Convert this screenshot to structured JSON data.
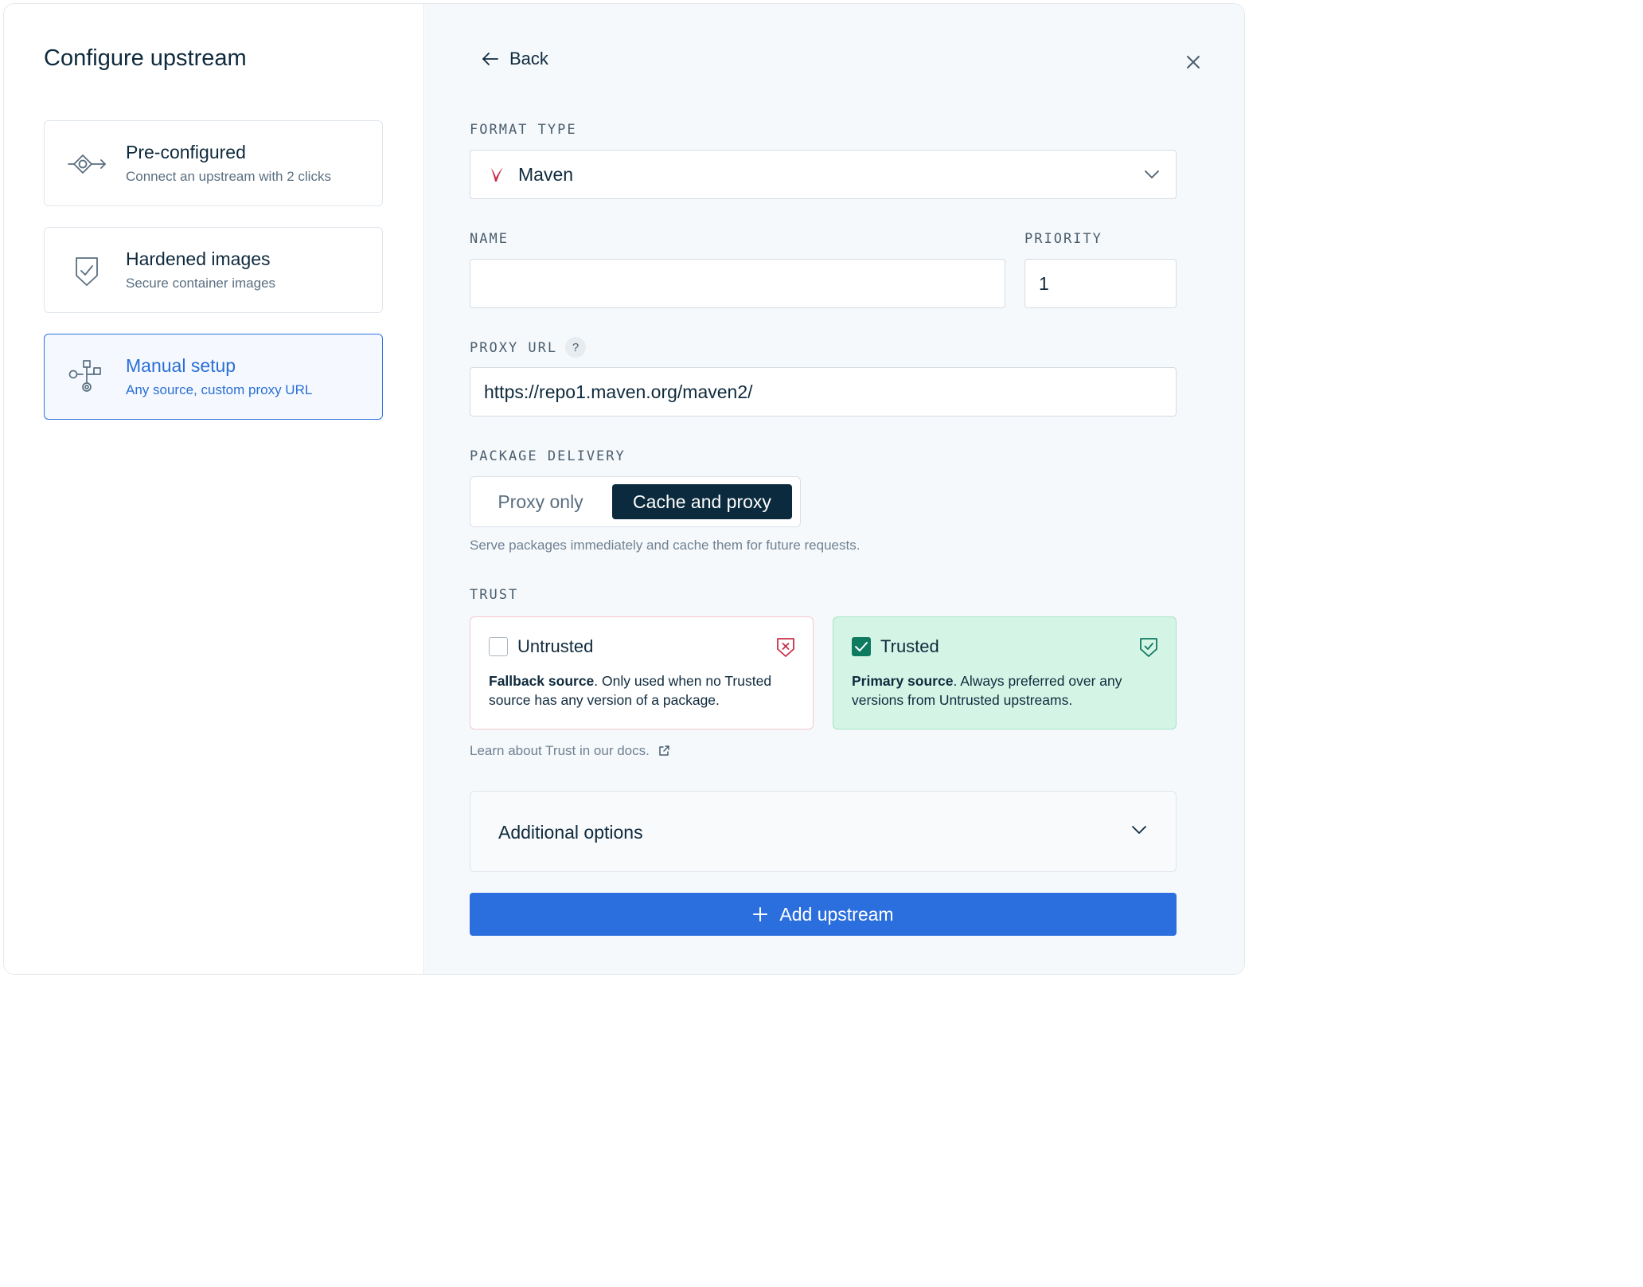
{
  "left_panel": {
    "title": "Configure upstream",
    "options": [
      {
        "title": "Pre-configured",
        "description": "Connect an upstream with 2 clicks",
        "icon": "connector-icon",
        "selected": false
      },
      {
        "title": "Hardened images",
        "description": "Secure container images",
        "icon": "shield-check-icon",
        "selected": false
      },
      {
        "title": "Manual setup",
        "description": "Any source, custom proxy URL",
        "icon": "workflow-icon",
        "selected": true
      }
    ]
  },
  "header": {
    "back_label": "Back",
    "back_icon": "arrow-left-icon",
    "close_icon": "close-icon"
  },
  "form": {
    "format_type": {
      "label": "FORMAT TYPE",
      "value": "Maven",
      "icon": "maven-feather-icon"
    },
    "name": {
      "label": "NAME",
      "value": ""
    },
    "priority": {
      "label": "PRIORITY",
      "value": "1"
    },
    "proxy_url": {
      "label": "PROXY URL",
      "help": "?",
      "value": "https://repo1.maven.org/maven2/"
    },
    "package_delivery": {
      "label": "PACKAGE DELIVERY",
      "options": [
        "Proxy only",
        "Cache and proxy"
      ],
      "selected": "Cache and proxy",
      "hint": "Serve packages immediately and cache them for future requests."
    },
    "trust": {
      "label": "TRUST",
      "untrusted": {
        "title": "Untrusted",
        "checked": false,
        "strong": "Fallback source",
        "text": ". Only used when no Trusted source has any version of a package.",
        "icon": "shield-x-icon"
      },
      "trusted": {
        "title": "Trusted",
        "checked": true,
        "strong": "Primary source",
        "text": ". Always preferred over any versions from Untrusted upstreams.",
        "icon": "shield-check-icon"
      },
      "docs_link": "Learn about Trust in our docs.",
      "docs_icon": "external-link-icon"
    },
    "additional_options": "Additional options",
    "submit_label": "Add upstream",
    "submit_icon": "plus-icon"
  },
  "colors": {
    "accent": "#2b6fde",
    "dark": "#0c2a3d",
    "trusted_bg": "#d4f5e6",
    "untrusted_border": "#f2c9cf"
  }
}
